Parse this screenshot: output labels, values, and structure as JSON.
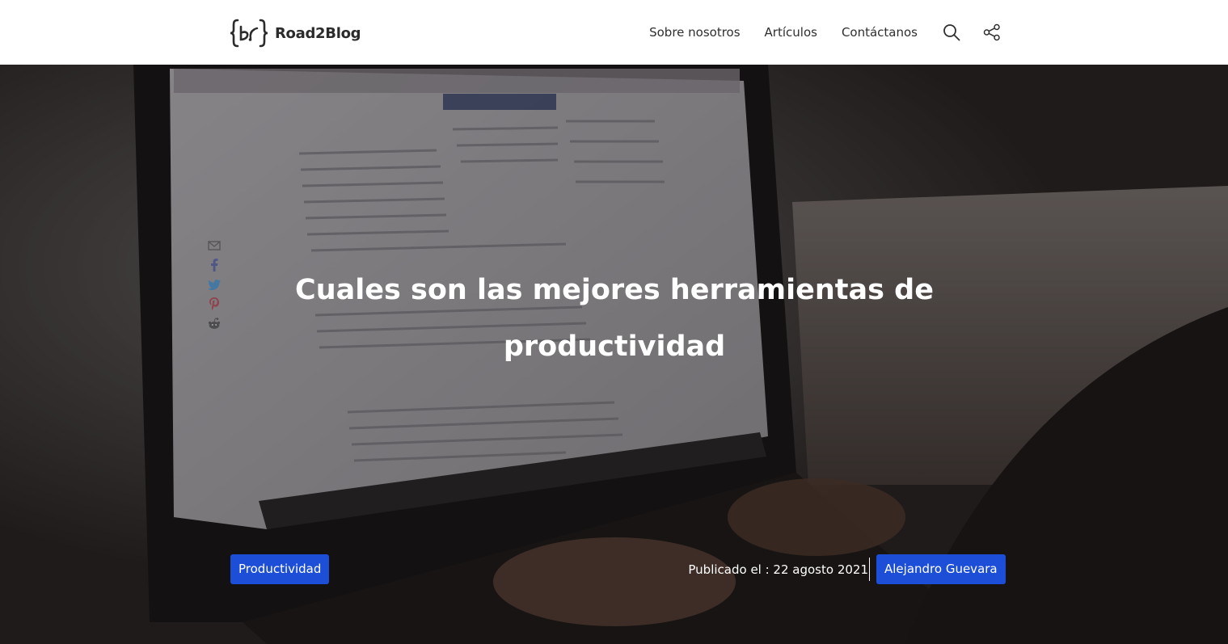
{
  "brand": {
    "name": "Road2Blog",
    "logo_icon": "wifi-braces-logo-icon"
  },
  "nav": {
    "links": [
      "Sobre nosotros",
      "Artículos",
      "Contáctanos"
    ],
    "search_icon": "search-icon",
    "share_icon": "share-icon"
  },
  "hero": {
    "title": "Cuales son las mejores herramientas de productividad",
    "category": "Productividad",
    "published": "Publicado el : 22 agosto 2021",
    "author": "Alejandro Guevara",
    "share_icons": [
      "email-icon",
      "facebook-icon",
      "twitter-icon",
      "pinterest-icon",
      "reddit-icon"
    ]
  },
  "colors": {
    "accent": "#1d4ed8",
    "header_bg": "#ffffff",
    "hero_text": "#ffffff"
  }
}
